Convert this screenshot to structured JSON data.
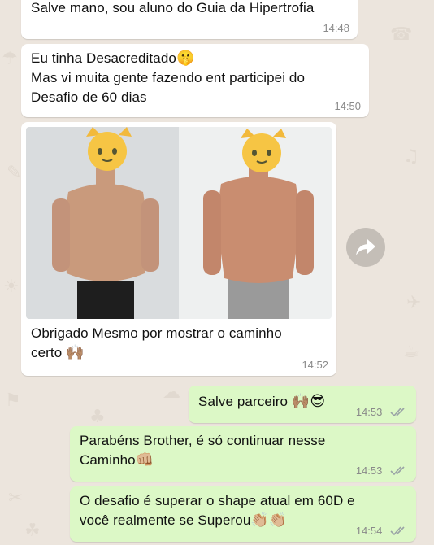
{
  "messages": [
    {
      "type": "text",
      "side": "in",
      "text": "Salve mano, sou aluno do Guia da Hipertrofia",
      "time": "14:48"
    },
    {
      "type": "text",
      "side": "in",
      "line1": "Eu tinha Desacreditado",
      "line2": "Mas vi muita gente fazendo ent  participei do",
      "line3": "Desafio de 60 dias",
      "time": "14:50",
      "emoji": "🤫"
    },
    {
      "type": "image",
      "side": "in",
      "caption_line1": "Obrigado Mesmo  por mostrar o caminho",
      "caption_line2": "certo",
      "emoji": "🙌🏽",
      "time": "14:52"
    },
    {
      "type": "text",
      "side": "out",
      "text": "Salve parceiro",
      "emoji": "🙌🏽😎",
      "time": "14:53"
    },
    {
      "type": "text",
      "side": "out",
      "line1": "Parabéns Brother, é só continuar nesse",
      "line2": "Caminho",
      "emoji": "👊🏼",
      "time": "14:53"
    },
    {
      "type": "text",
      "side": "out",
      "line1": "O desafio é superar o shape atual em 60D e",
      "line2": "você realmente  se Superou",
      "emoji": "👏🏼👏🏼",
      "time": "14:54"
    }
  ],
  "colors": {
    "incoming": "#ffffff",
    "outgoing": "#dcf8c6",
    "chat_bg": "#ece5dd",
    "tick": "#9aa3a6"
  },
  "icons": {
    "forward": "forward-arrow-icon",
    "read_receipt": "double-check-icon",
    "face_cover": "cat-face-emoji"
  }
}
